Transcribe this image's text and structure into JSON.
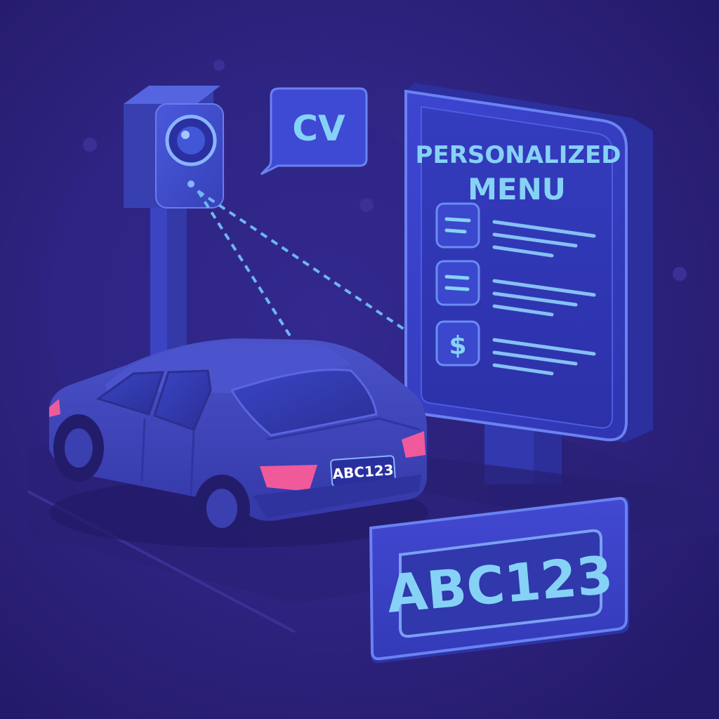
{
  "speech_bubble": {
    "label": "CV"
  },
  "menu_board": {
    "title_line1": "PERSONALIZED",
    "title_line2": "MENU",
    "items": [
      {
        "icon": "list-icon"
      },
      {
        "icon": "list-icon"
      },
      {
        "icon": "dollar-icon",
        "symbol": "$"
      }
    ]
  },
  "car": {
    "plate": "ABC123"
  },
  "plate_callout": {
    "plate": "ABC123"
  },
  "colors": {
    "background": "#2b2178",
    "accent_cyan": "#7fd0f5",
    "accent_blue": "#4b6cf0",
    "tail_light": "#f05a9a",
    "panel": "#3a3fc8"
  }
}
